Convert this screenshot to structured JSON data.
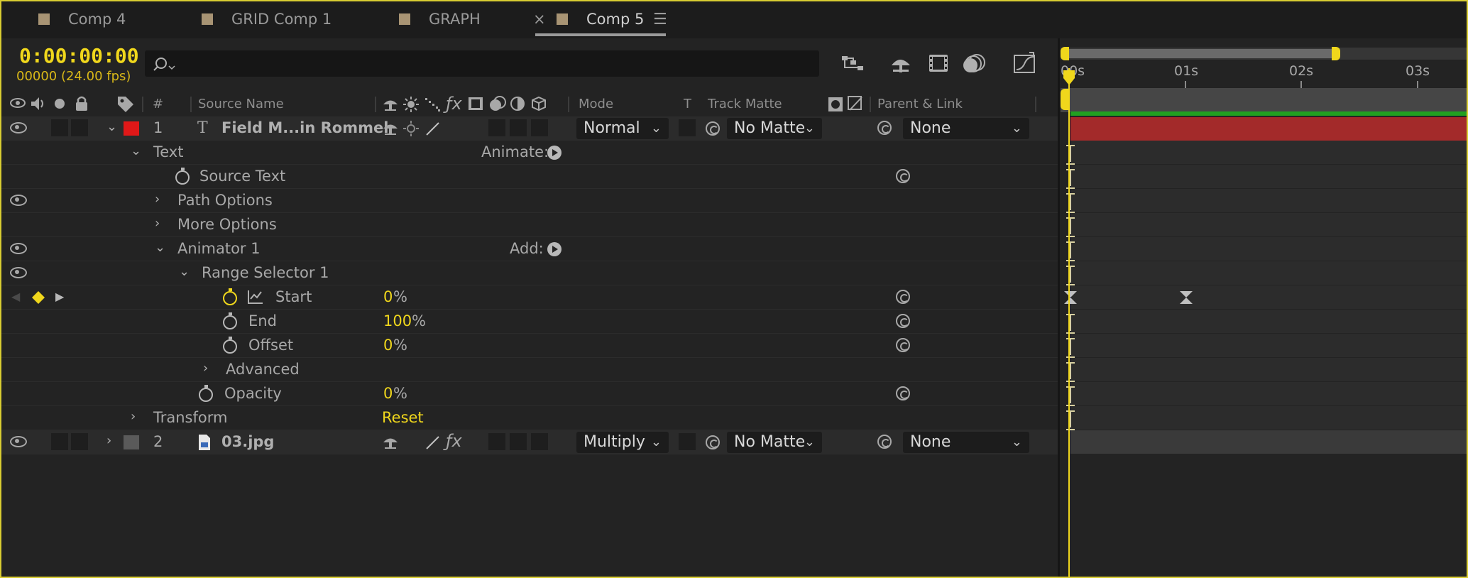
{
  "tabs": [
    {
      "label": "Comp 4"
    },
    {
      "label": "GRID Comp 1"
    },
    {
      "label": "GRAPH"
    },
    {
      "label": "Comp 5"
    }
  ],
  "tab_close_glyph": "×",
  "tab_menu_glyph": "☰",
  "timecode": "0:00:00:00",
  "frame_info": "00000 (24.00 fps)",
  "search": {
    "placeholder": ""
  },
  "columns": {
    "number": "#",
    "source_name": "Source Name",
    "mode": "Mode",
    "t": "T",
    "track_matte": "Track Matte",
    "parent_link": "Parent & Link"
  },
  "layers": [
    {
      "num": "1",
      "name": "Field M...in Rommel",
      "mode": "Normal",
      "matte": "No Matte",
      "parent": "None",
      "label_color": "#e01818"
    },
    {
      "num": "2",
      "name": "03.jpg",
      "mode": "Multiply",
      "matte": "No Matte",
      "parent": "None",
      "label_color": "#5a5a5a"
    }
  ],
  "props": {
    "text": "Text",
    "animate_label": "Animate:",
    "source_text": "Source Text",
    "path_options": "Path Options",
    "more_options": "More Options",
    "animator": "Animator 1",
    "add_label": "Add:",
    "range_selector": "Range Selector 1",
    "start": {
      "label": "Start",
      "value": "0",
      "unit": "%"
    },
    "end": {
      "label": "End",
      "value": "100",
      "unit": "%"
    },
    "offset": {
      "label": "Offset",
      "value": "0",
      "unit": "%"
    },
    "advanced": "Advanced",
    "opacity": {
      "label": "Opacity",
      "value": "0",
      "unit": "%"
    },
    "transform": "Transform",
    "reset": "Reset"
  },
  "ruler": {
    "labels": [
      "00s",
      "01s",
      "02s",
      "03s"
    ]
  },
  "colors": {
    "accent": "#f0d71c",
    "layer1_bar": "#a32a2a",
    "green_bar": "#21a021"
  }
}
